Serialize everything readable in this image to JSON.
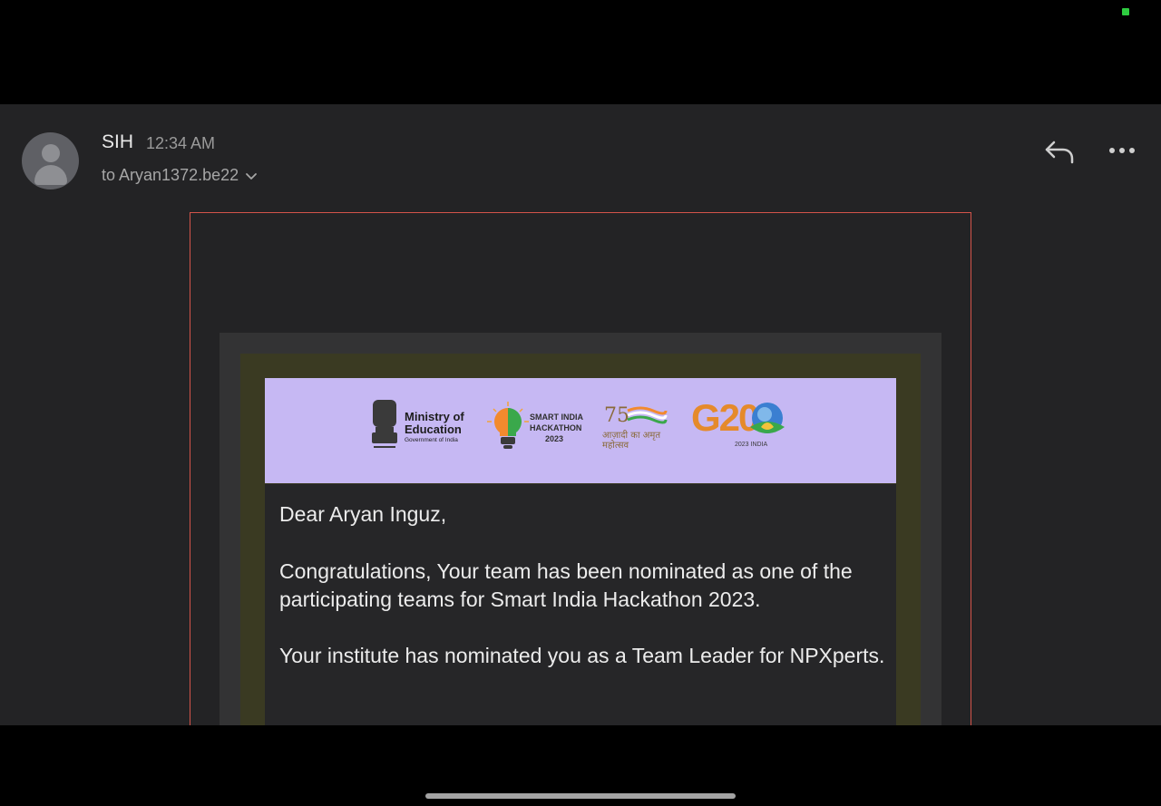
{
  "email": {
    "sender": "SIH",
    "time": "12:34 AM",
    "recipient": "to Aryan1372.be22"
  },
  "banner": {
    "moe_title": "Ministry of Education",
    "moe_sub": "Government of India",
    "sih_line1": "SMART INDIA",
    "sih_line2": "HACKATHON",
    "sih_line3": "2023",
    "g20_text": "G20",
    "g20_sub": "2023 INDIA",
    "azadi_text": "आज़ादी का अमृत महोत्सव"
  },
  "body": {
    "greeting": "Dear Aryan Inguz,",
    "para1": "Congratulations, Your team has been nominated as one of the participating teams for Smart India Hackathon 2023.",
    "para2": "Your institute has nominated you as a Team Leader for NPXperts."
  },
  "colors": {
    "frame_border": "#d4544a",
    "banner_bg": "#c6b8f3",
    "status_green": "#2ecc40"
  }
}
